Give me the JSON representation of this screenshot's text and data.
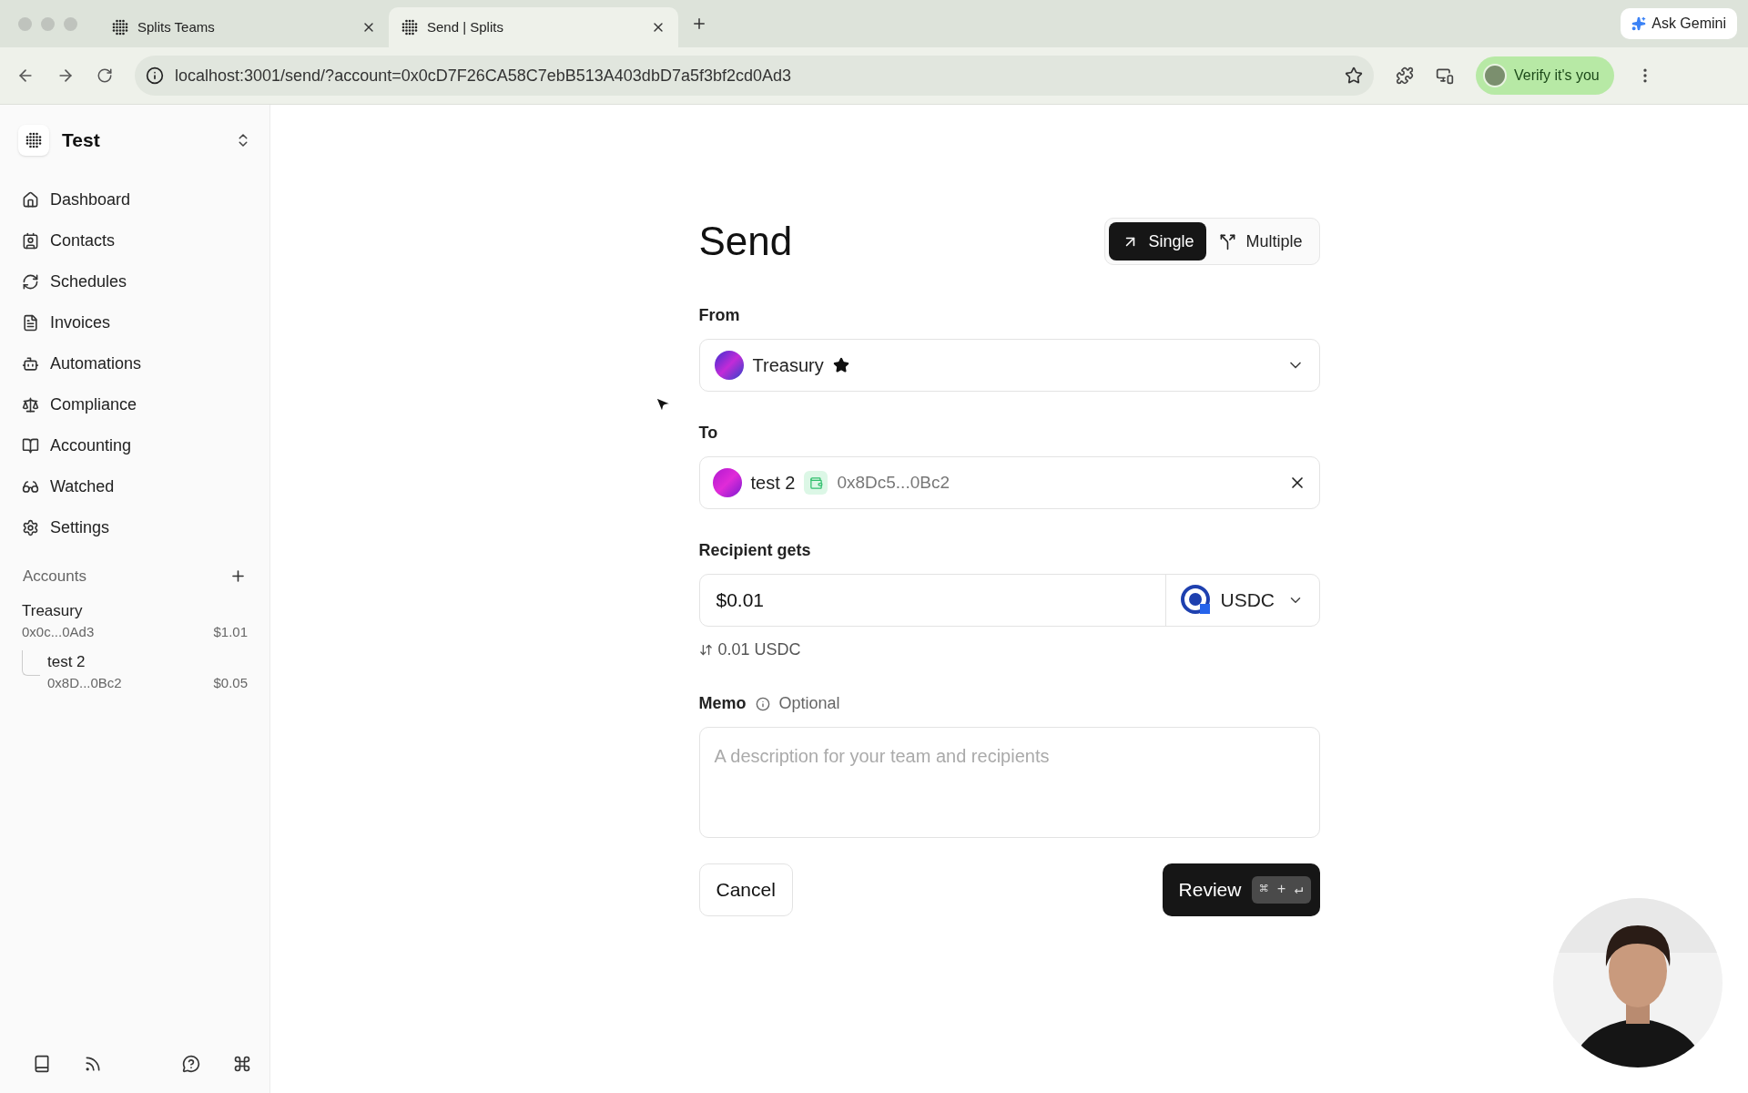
{
  "browser": {
    "tabs": [
      {
        "title": "Splits Teams",
        "selected": false
      },
      {
        "title": "Send | Splits",
        "selected": true
      }
    ],
    "ask_button": "Ask Gemini",
    "url": "localhost:3001/send/?account=0x0cD7F26CA58C7ebB513A403dbD7a5f3bf2cd0Ad3",
    "profile_button": "Verify it's you"
  },
  "sidebar": {
    "workspace": "Test",
    "nav": [
      {
        "label": "Dashboard"
      },
      {
        "label": "Contacts"
      },
      {
        "label": "Schedules"
      },
      {
        "label": "Invoices"
      },
      {
        "label": "Automations"
      },
      {
        "label": "Compliance"
      },
      {
        "label": "Accounting"
      },
      {
        "label": "Watched"
      },
      {
        "label": "Settings"
      }
    ],
    "accounts_heading": "Accounts",
    "accounts": [
      {
        "name": "Treasury",
        "address": "0x0c...0Ad3",
        "balance": "$1.01",
        "children": [
          {
            "name": "test 2",
            "address": "0x8D...0Bc2",
            "balance": "$0.05"
          }
        ]
      }
    ]
  },
  "send": {
    "title": "Send",
    "modes": [
      {
        "label": "Single",
        "selected": true
      },
      {
        "label": "Multiple",
        "selected": false
      }
    ],
    "from": {
      "label": "From",
      "value": "Treasury"
    },
    "to": {
      "label": "To",
      "name": "test 2",
      "address": "0x8Dc5...0Bc2"
    },
    "amount": {
      "label": "Recipient gets",
      "value": "$0.01",
      "token": "USDC",
      "conversion": "0.01 USDC"
    },
    "memo": {
      "label": "Memo",
      "hint": "Optional",
      "placeholder": "A description for your team and recipients"
    },
    "cancel": "Cancel",
    "review": "Review",
    "shortcut": "⌘ + ↵"
  }
}
